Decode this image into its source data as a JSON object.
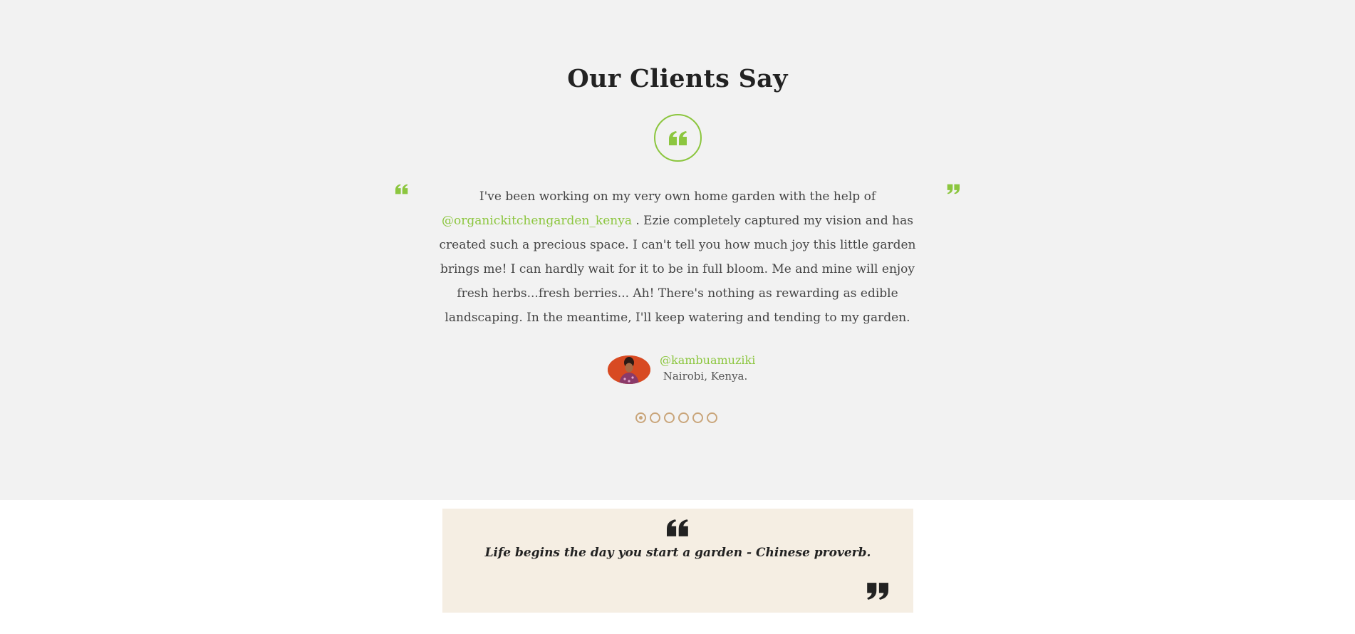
{
  "section": {
    "title": "Our Clients Say"
  },
  "testimonial": {
    "text_before": "I've been working on my very own home garden with the help of",
    "handle": "@organickitchengarden_kenya",
    "text_after": ". Ezie completely captured my vision and has created such a precious space. I can't tell you how much joy this little garden brings me! I can hardly wait for it to be in full bloom. Me and mine will enjoy fresh herbs...fresh berries... Ah! There's nothing as rewarding as edible landscaping. In the meantime, I'll keep watering and tending to my garden.",
    "author_name": "@kambuamuziki",
    "author_location": "Nairobi, Kenya."
  },
  "carousel": {
    "slide_count": 6,
    "active_index": 0
  },
  "proverb": {
    "text": "Life begins the day you start a garden - Chinese proverb."
  },
  "colors": {
    "accent_green": "#8cc63f",
    "dot_tan": "#c9a57a",
    "section_bg": "#f2f2f2",
    "proverb_bg": "#f5eee3"
  },
  "icons": {
    "section_quote": "quote-left-icon",
    "side_open": "quote-left-icon",
    "side_close": "quote-right-icon",
    "proverb_open": "quote-left-icon",
    "proverb_close": "quote-right-icon"
  }
}
